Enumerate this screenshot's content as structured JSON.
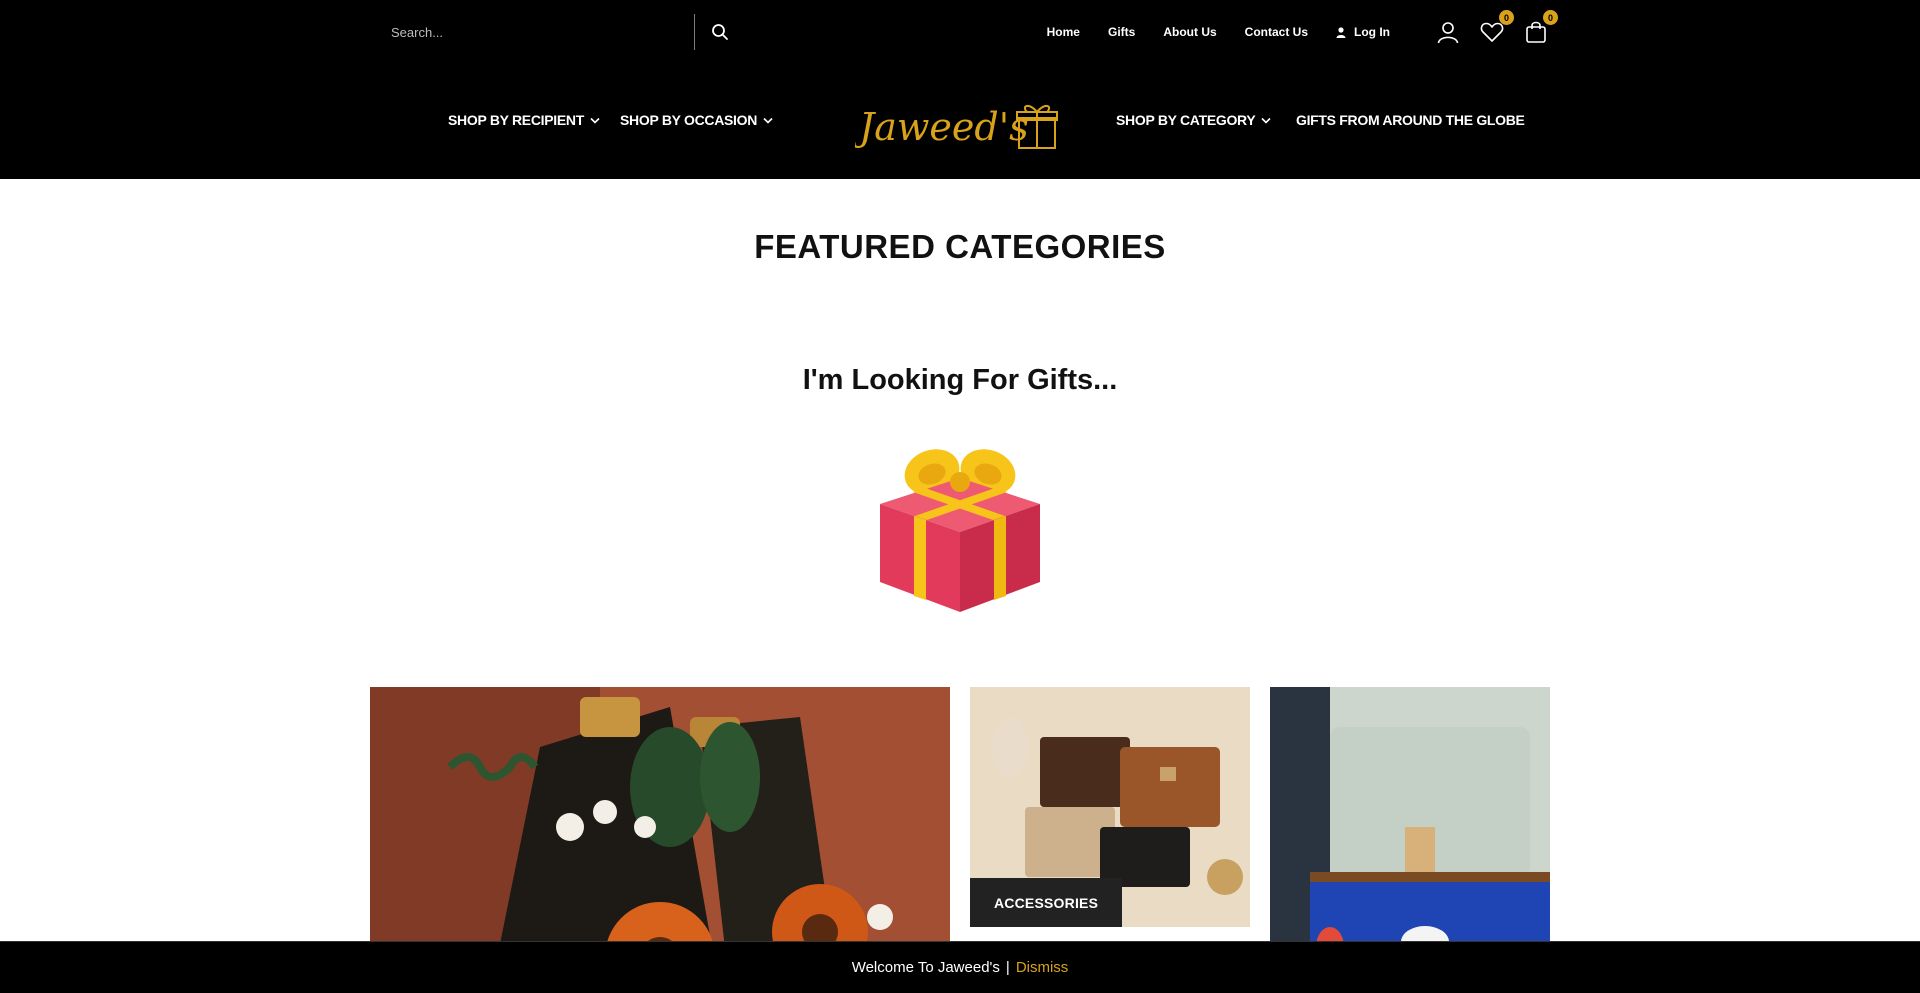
{
  "search": {
    "placeholder": "Search..."
  },
  "top_links": {
    "home": "Home",
    "gifts": "Gifts",
    "about": "About Us",
    "contact": "Contact Us",
    "login": "Log In"
  },
  "wishlist_count": "0",
  "cart_count": "0",
  "nav": {
    "recipient": "SHOP BY RECIPIENT",
    "occasion": "SHOP BY OCCASION",
    "category": "SHOP BY CATEGORY",
    "globe": "GIFTS FROM AROUND THE GLOBE"
  },
  "logo_text": "Jaweed's",
  "featured_title": "FEATURED CATEGORIES",
  "looking_title": "I'm Looking For Gifts...",
  "tiles": {
    "accessories_label": "ACCESSORIES"
  },
  "notice": {
    "message": "Welcome To Jaweed's",
    "separator": "|",
    "dismiss": "Dismiss"
  },
  "colors": {
    "header_bg": "#000000",
    "accent_gold": "#d8a21a",
    "gift_box_red": "#e23a5a",
    "gift_ribbon_yellow": "#f7c51a"
  }
}
